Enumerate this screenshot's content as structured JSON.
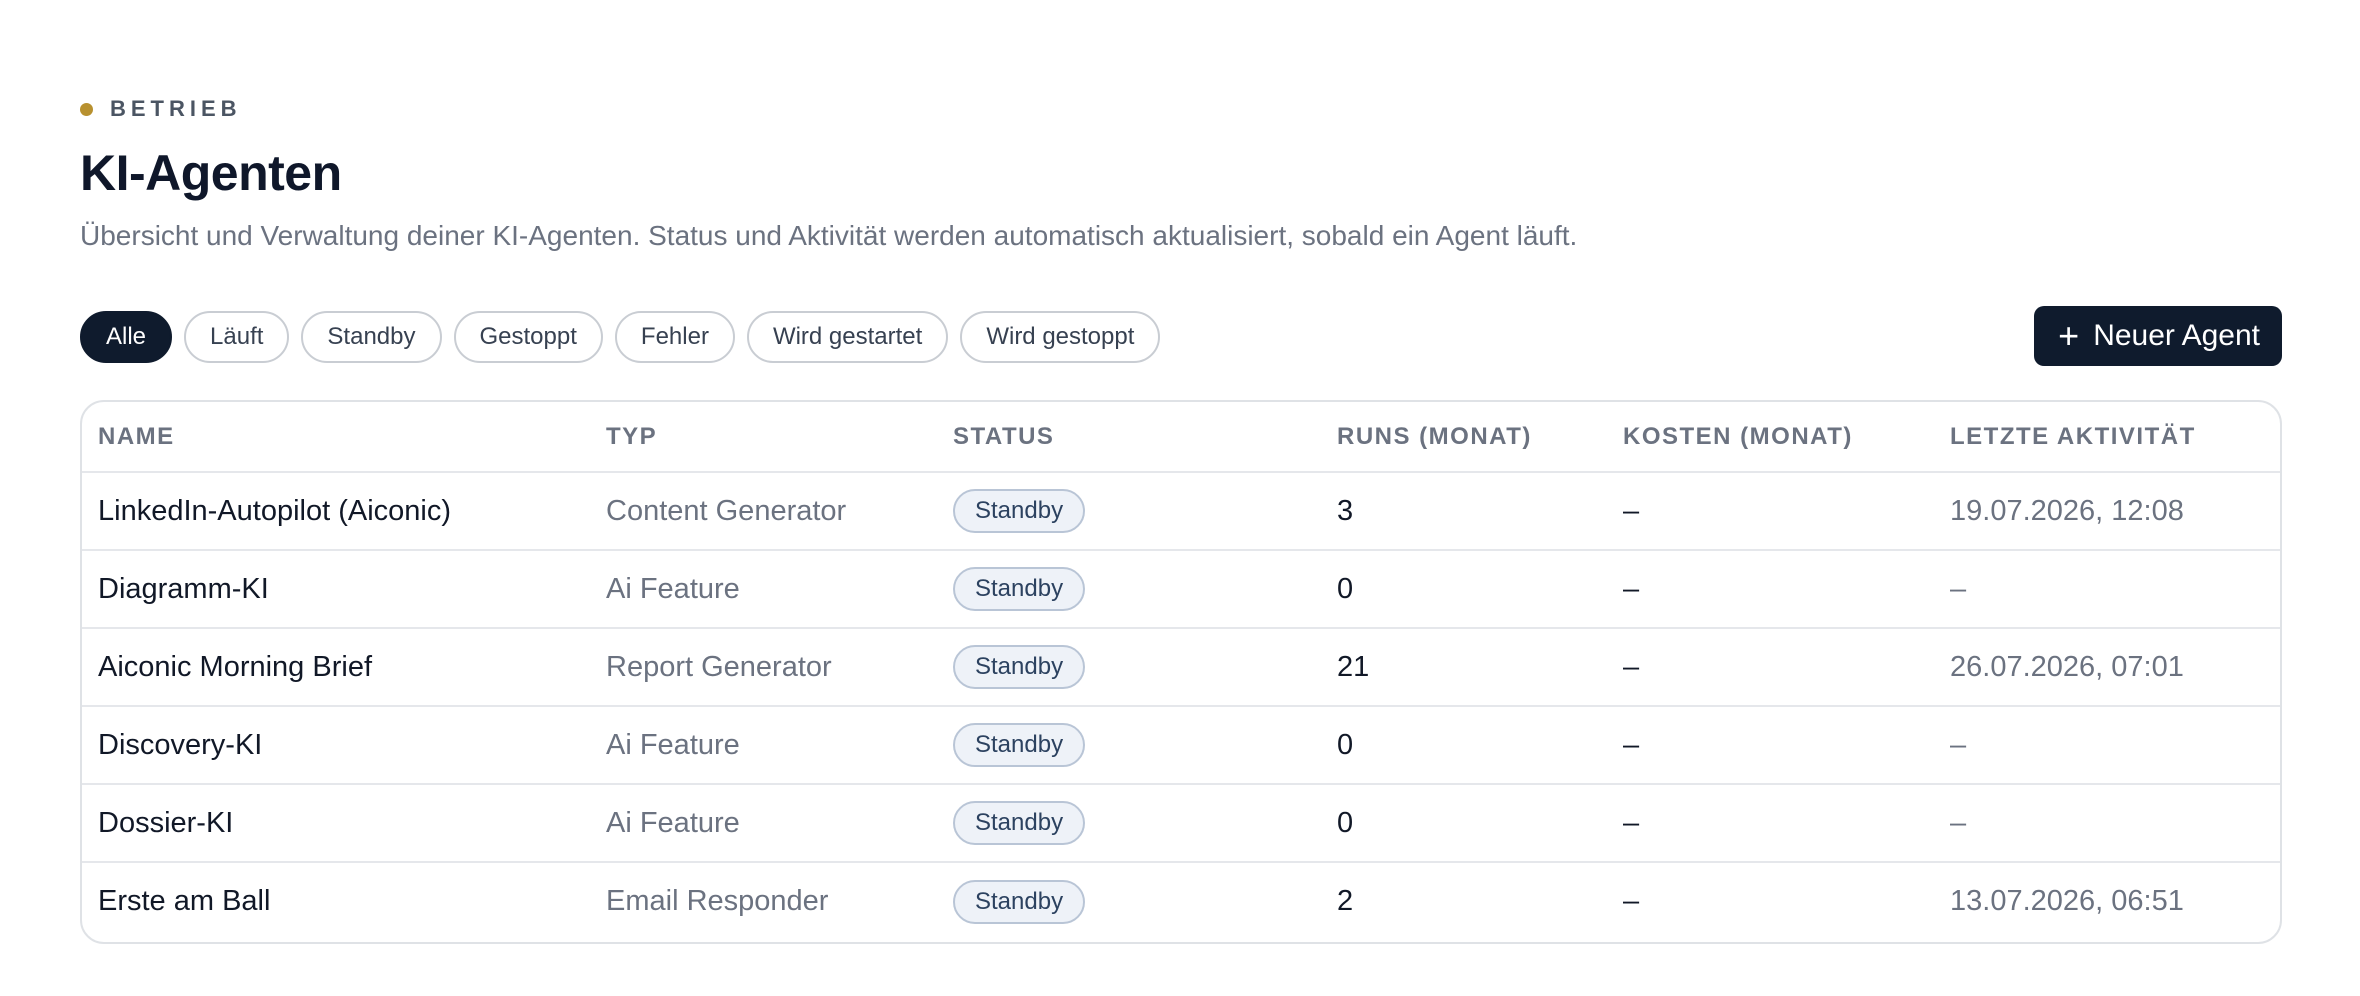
{
  "eyebrow": {
    "label": "BETRIEB",
    "dot_color": "#b8912f"
  },
  "header": {
    "title": "KI-Agenten",
    "subtitle": "Übersicht und Verwaltung deiner KI-Agenten. Status und Aktivität werden automatisch aktualisiert, sobald ein Agent läuft."
  },
  "filters": [
    {
      "label": "Alle",
      "active": true
    },
    {
      "label": "Läuft",
      "active": false
    },
    {
      "label": "Standby",
      "active": false
    },
    {
      "label": "Gestoppt",
      "active": false
    },
    {
      "label": "Fehler",
      "active": false
    },
    {
      "label": "Wird gestartet",
      "active": false
    },
    {
      "label": "Wird gestoppt",
      "active": false
    }
  ],
  "new_agent_button": {
    "icon": "plus-icon",
    "label": "Neuer Agent",
    "color": "#0f1b2d"
  },
  "table": {
    "columns": [
      "NAME",
      "TYP",
      "STATUS",
      "RUNS (MONAT)",
      "KOSTEN (MONAT)",
      "LETZTE AKTIVITÄT"
    ],
    "rows": [
      {
        "name": "LinkedIn-Autopilot (Aiconic)",
        "type": "Content Generator",
        "status": "Standby",
        "runs": "3",
        "cost": "–",
        "activity": "19.07.2026, 12:08"
      },
      {
        "name": "Diagramm-KI",
        "type": "Ai Feature",
        "status": "Standby",
        "runs": "0",
        "cost": "–",
        "activity": "–"
      },
      {
        "name": "Aiconic Morning Brief",
        "type": "Report Generator",
        "status": "Standby",
        "runs": "21",
        "cost": "–",
        "activity": "26.07.2026, 07:01"
      },
      {
        "name": "Discovery-KI",
        "type": "Ai Feature",
        "status": "Standby",
        "runs": "0",
        "cost": "–",
        "activity": "–"
      },
      {
        "name": "Dossier-KI",
        "type": "Ai Feature",
        "status": "Standby",
        "runs": "0",
        "cost": "–",
        "activity": "–"
      },
      {
        "name": "Erste am Ball",
        "type": "Email Responder",
        "status": "Standby",
        "runs": "2",
        "cost": "–",
        "activity": "13.07.2026, 06:51"
      }
    ]
  }
}
